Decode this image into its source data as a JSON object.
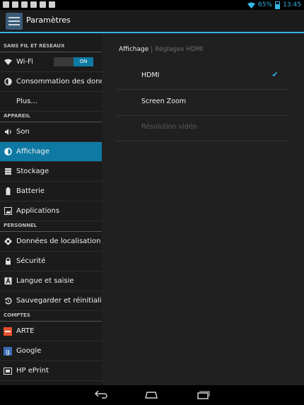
{
  "status_bar": {
    "battery_percent": "65%",
    "time": "13:45",
    "left_icons": [
      "notification-icon",
      "app-icon",
      "gallery-icon",
      "usb-icon",
      "bag-icon",
      "briefcase-icon"
    ],
    "accent_color": "#33b5e5"
  },
  "action_bar": {
    "title": "Paramètres",
    "icon": "settings-sliders-icon"
  },
  "sidebar": {
    "sections": [
      {
        "header": "SANS FIL ET RÉSEAUX",
        "items": [
          {
            "label": "Wi-Fi",
            "icon": "wifi-icon",
            "toggle": "ON"
          },
          {
            "label": "Consommation des données",
            "icon": "data-usage-icon"
          },
          {
            "label": "Plus..."
          }
        ]
      },
      {
        "header": "APPAREIL",
        "items": [
          {
            "label": "Son",
            "icon": "speaker-icon"
          },
          {
            "label": "Affichage",
            "icon": "brightness-icon",
            "selected": true
          },
          {
            "label": "Stockage",
            "icon": "storage-icon"
          },
          {
            "label": "Batterie",
            "icon": "battery-icon"
          },
          {
            "label": "Applications",
            "icon": "apps-icon"
          }
        ]
      },
      {
        "header": "PERSONNEL",
        "items": [
          {
            "label": "Données de localisation",
            "icon": "location-icon"
          },
          {
            "label": "Sécurité",
            "icon": "lock-icon"
          },
          {
            "label": "Langue et saisie",
            "icon": "keyboard-icon"
          },
          {
            "label": "Sauvegarder et réinitialiser",
            "icon": "backup-icon"
          }
        ]
      },
      {
        "header": "COMPTES",
        "items": [
          {
            "label": "ARTE",
            "icon": "arte-icon"
          },
          {
            "label": "Google",
            "icon": "google-icon"
          },
          {
            "label": "HP ePrint",
            "icon": "hp-eprint-icon"
          }
        ]
      }
    ]
  },
  "detail": {
    "breadcrumb": [
      "Affichage",
      "Réglages HDMI"
    ],
    "prefs": [
      {
        "label": "HDMI",
        "checked": true,
        "enabled": true
      },
      {
        "label": "Screen Zoom",
        "enabled": true
      },
      {
        "label": "Résolution vidéo",
        "enabled": false
      }
    ]
  },
  "nav_bar": [
    "back-icon",
    "home-icon",
    "recents-icon"
  ]
}
